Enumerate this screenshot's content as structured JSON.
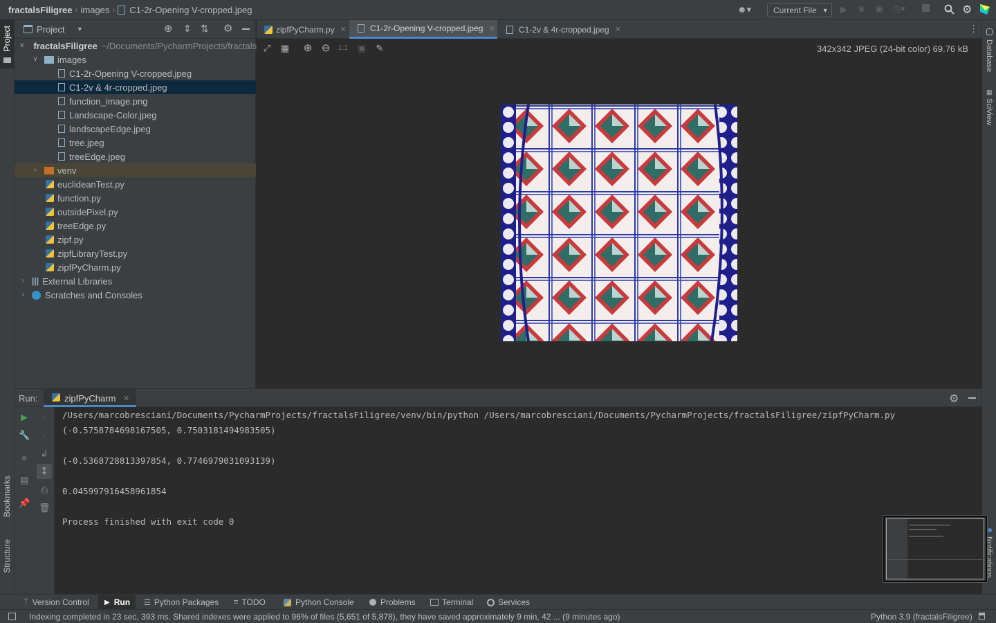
{
  "breadcrumb": {
    "project": "fractalsFiligree",
    "folder": "images",
    "file": "C1-2r-Opening V-cropped.jpeg"
  },
  "run_config": {
    "label": "Current File"
  },
  "left_stripe": {
    "project_tab": "Project",
    "bookmarks_tab": "Bookmarks",
    "structure_tab": "Structure"
  },
  "right_stripe": {
    "database_tab": "Database",
    "sciview_tab": "SciView",
    "notifications_tab": "Notifications"
  },
  "project_panel": {
    "title": "Project",
    "root": {
      "name": "fractalsFiligree",
      "path": "~/Documents/PycharmProjects/fractalsFiligree"
    },
    "images_folder": "images",
    "image_files": [
      "C1-2r-Opening V-cropped.jpeg",
      "C1-2v & 4r-cropped.jpeg",
      "function_image.png",
      "Landscape-Color.jpeg",
      "landscapeEdge.jpeg",
      "tree.jpeg",
      "treeEdge.jpeg"
    ],
    "selected_file": "C1-2v & 4r-cropped.jpeg",
    "venv_folder": "venv",
    "py_files": [
      "euclideanTest.py",
      "function.py",
      "outsidePixel.py",
      "treeEdge.py",
      "zipf.py",
      "zipfLibraryTest.py",
      "zipfPyCharm.py"
    ],
    "external_libraries": "External Libraries",
    "scratches": "Scratches and Consoles"
  },
  "editor_tabs": [
    {
      "label": "zipfPyCharm.py",
      "active": false
    },
    {
      "label": "C1-2r-Opening V-cropped.jpeg",
      "active": true
    },
    {
      "label": "C1-2v & 4r-cropped.jpeg",
      "active": false
    }
  ],
  "image_viewer": {
    "zoom_actual_label": "1:1",
    "info": "342x342 JPEG (24-bit color) 69.76 kB"
  },
  "run_panel": {
    "label": "Run:",
    "tab_label": "zipfPyCharm",
    "console_lines": [
      "/Users/marcobresciani/Documents/PycharmProjects/fractalsFiligree/venv/bin/python /Users/marcobresciani/Documents/PycharmProjects/fractalsFiligree/zipfPyCharm.py",
      "(-0.5758784698167505, 0.7503181494983505)",
      "",
      "(-0.5368728813397854, 0.7746979031093139)",
      "",
      "0.045997916458961854",
      "",
      "Process finished with exit code 0"
    ]
  },
  "tool_tabs": [
    "Version Control",
    "Run",
    "Python Packages",
    "TODO",
    "Python Console",
    "Problems",
    "Terminal",
    "Services"
  ],
  "active_tool_tab": "Run",
  "status": {
    "message": "Indexing completed in 23 sec, 393 ms. Shared indexes were applied to 96% of files (5,651 of 5,878), they have saved approximately 9 min, 42 ... (9 minutes ago)",
    "interpreter": "Python 3.9 (fractalsFiligree)"
  },
  "colors": {
    "background": "#2b2b2b",
    "panel": "#3c3f41",
    "selection": "#0d293e",
    "accent": "#4a88c7",
    "run_green": "#499c54"
  }
}
